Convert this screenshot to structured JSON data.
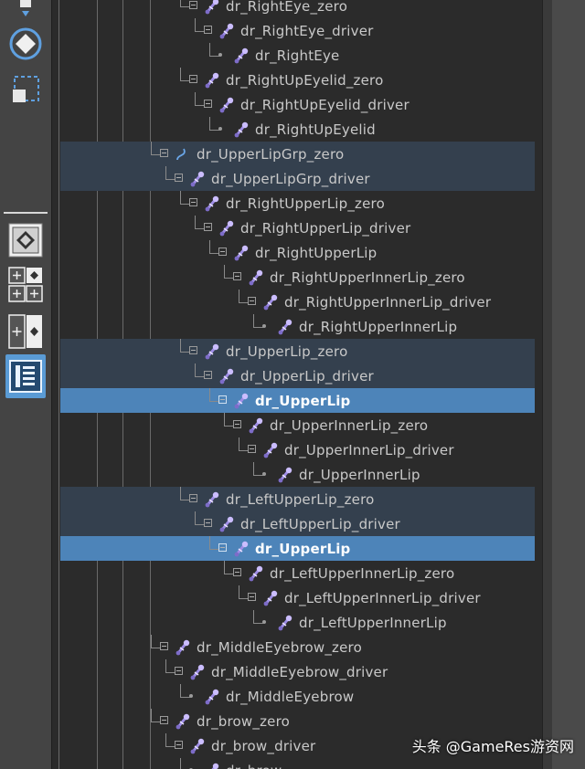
{
  "toolbar": {
    "tools": [
      {
        "icon": "move-tool-icon"
      },
      {
        "icon": "rotate-tool-icon"
      },
      {
        "icon": "select-region-icon"
      },
      {
        "icon": "single-view-icon"
      },
      {
        "icon": "four-view-icon"
      },
      {
        "icon": "two-view-icon"
      },
      {
        "icon": "outliner-layout-icon"
      }
    ]
  },
  "outliner": {
    "rows": [
      {
        "label": "dr_RightEye_zero",
        "state": "normal"
      },
      {
        "label": "dr_RightEye_driver",
        "state": "normal"
      },
      {
        "label": "dr_RightEye",
        "state": "normal"
      },
      {
        "label": "dr_RightUpEyelid_zero",
        "state": "normal"
      },
      {
        "label": "dr_RightUpEyelid_driver",
        "state": "normal"
      },
      {
        "label": "dr_RightUpEyelid",
        "state": "normal"
      },
      {
        "label": "dr_UpperLipGrp_zero",
        "state": "dimmed"
      },
      {
        "label": "dr_UpperLipGrp_driver",
        "state": "dimmed"
      },
      {
        "label": "dr_RightUpperLip_zero",
        "state": "normal"
      },
      {
        "label": "dr_RightUpperLip_driver",
        "state": "normal"
      },
      {
        "label": "dr_RightUpperLip",
        "state": "normal"
      },
      {
        "label": "dr_RightUpperInnerLip_zero",
        "state": "normal"
      },
      {
        "label": "dr_RightUpperInnerLip_driver",
        "state": "normal"
      },
      {
        "label": "dr_RightUpperInnerLip",
        "state": "normal"
      },
      {
        "label": "dr_UpperLip_zero",
        "state": "dimmed"
      },
      {
        "label": "dr_UpperLip_driver",
        "state": "dimmed"
      },
      {
        "label": "dr_UpperLip",
        "state": "selected"
      },
      {
        "label": "dr_UpperInnerLip_zero",
        "state": "normal"
      },
      {
        "label": "dr_UpperInnerLip_driver",
        "state": "normal"
      },
      {
        "label": "dr_UpperInnerLip",
        "state": "normal"
      },
      {
        "label": "dr_LeftUpperLip_zero",
        "state": "dimmed"
      },
      {
        "label": "dr_LeftUpperLip_driver",
        "state": "dimmed"
      },
      {
        "label": "dr_UpperLip",
        "state": "selected"
      },
      {
        "label": "dr_LeftUpperInnerLip_zero",
        "state": "normal"
      },
      {
        "label": "dr_LeftUpperInnerLip_driver",
        "state": "normal"
      },
      {
        "label": "dr_LeftUpperInnerLip",
        "state": "normal"
      },
      {
        "label": "dr_MiddleEyebrow_zero",
        "state": "normal"
      },
      {
        "label": "dr_MiddleEyebrow_driver",
        "state": "normal"
      },
      {
        "label": "dr_MiddleEyebrow",
        "state": "normal"
      },
      {
        "label": "dr_brow_zero",
        "state": "normal"
      },
      {
        "label": "dr_brow_driver",
        "state": "normal"
      },
      {
        "label": "dr_brow",
        "state": "normal"
      }
    ]
  },
  "watermark": "头条 @GameRes游资网",
  "colors": {
    "selected_row": "#4d84b9",
    "dimmed_row": "#34404e",
    "joint_icon": "#b9a8f0"
  }
}
